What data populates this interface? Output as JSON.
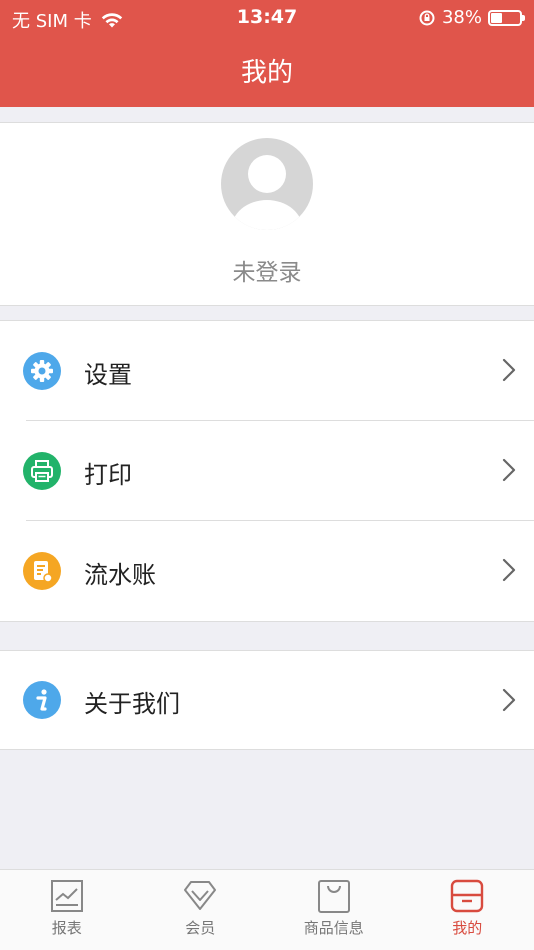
{
  "status": {
    "carrier": "无 SIM 卡",
    "time": "13:47",
    "battery": "38%",
    "battery_level": 0.38
  },
  "header": {
    "title": "我的"
  },
  "profile": {
    "login_text": "未登录"
  },
  "menu": {
    "items": [
      {
        "label": "设置",
        "icon": "gear-icon",
        "color": "#4ea8ea"
      },
      {
        "label": "打印",
        "icon": "printer-icon",
        "color": "#22b36a"
      },
      {
        "label": "流水账",
        "icon": "ledger-icon",
        "color": "#f5a623"
      }
    ]
  },
  "about": {
    "label": "关于我们",
    "icon": "info-icon",
    "color": "#4ea8ea"
  },
  "tabbar": {
    "tabs": [
      {
        "label": "报表",
        "icon": "report-icon"
      },
      {
        "label": "会员",
        "icon": "diamond-icon"
      },
      {
        "label": "商品信息",
        "icon": "bag-icon"
      },
      {
        "label": "我的",
        "icon": "profile-card-icon",
        "active": true
      }
    ]
  },
  "colors": {
    "accent": "#e0554b"
  }
}
